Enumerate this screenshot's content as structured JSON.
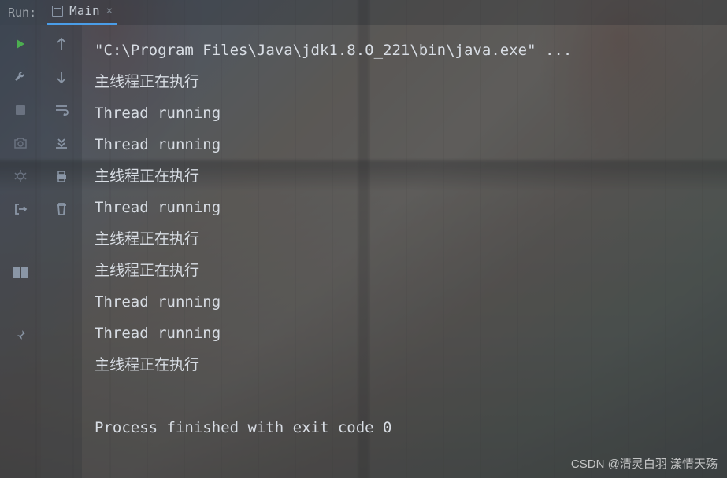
{
  "header": {
    "run_label": "Run:",
    "tab_label": "Main",
    "tab_close": "×"
  },
  "console": {
    "lines": [
      "\"C:\\Program Files\\Java\\jdk1.8.0_221\\bin\\java.exe\" ...",
      "主线程正在执行",
      "Thread running",
      "Thread running",
      "主线程正在执行",
      "Thread running",
      "主线程正在执行",
      "主线程正在执行",
      "Thread running",
      "Thread running",
      "主线程正在执行",
      "",
      "Process finished with exit code 0"
    ]
  },
  "watermark": "CSDN @清灵白羽 漾情天殇"
}
